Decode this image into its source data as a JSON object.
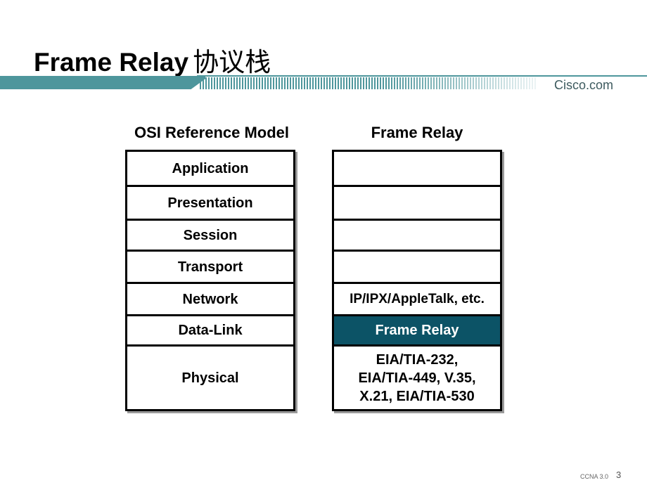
{
  "slide": {
    "title_latin": "Frame Relay",
    "title_cjk": "协议栈",
    "brand": "Cisco.com",
    "footer_course": "CCNA 3.0",
    "page_number": "3",
    "colors": {
      "banner": "#4e969c",
      "highlight": "#0c5366",
      "border": "#000000"
    }
  },
  "osi": {
    "heading": "OSI Reference Model",
    "layers": [
      "Application",
      "Presentation",
      "Session",
      "Transport",
      "Network",
      "Data-Link",
      "Physical"
    ]
  },
  "frame_relay": {
    "heading": "Frame Relay",
    "layers": [
      "",
      "",
      "",
      "",
      "IP/IPX/AppleTalk, etc.",
      "Frame Relay",
      "EIA/TIA-232,\nEIA/TIA-449, V.35,\nX.21, EIA/TIA-530"
    ],
    "highlighted_layer": "Frame Relay"
  }
}
